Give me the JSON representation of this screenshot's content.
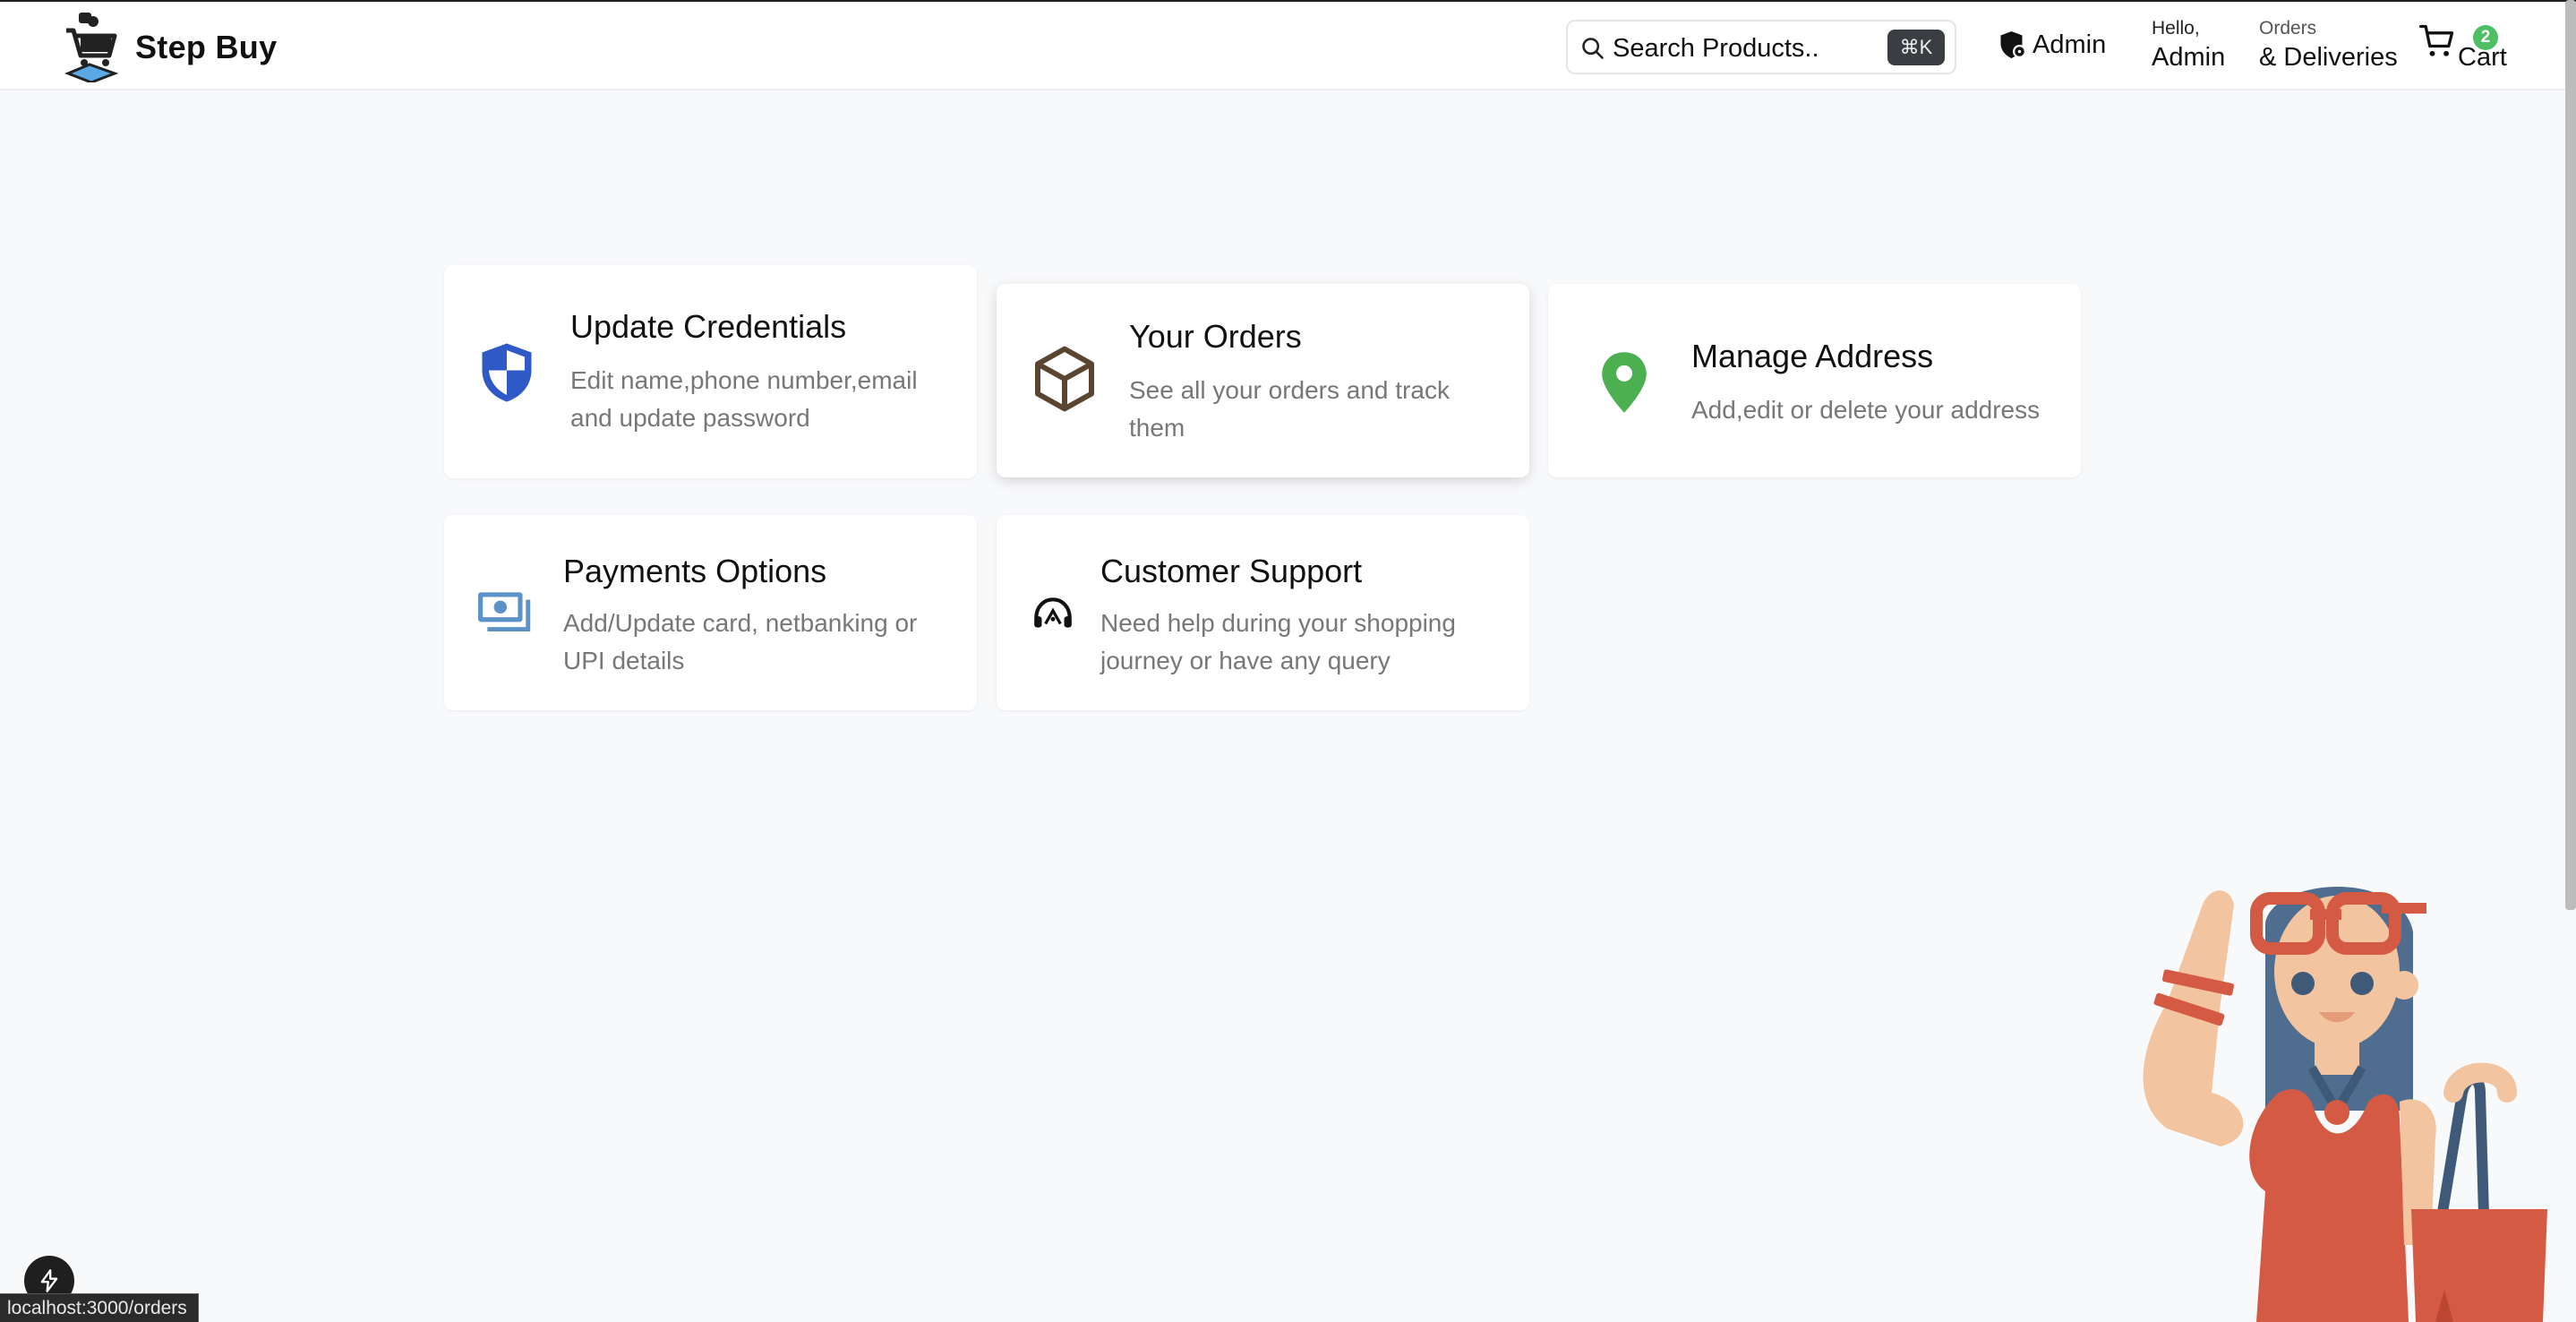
{
  "header": {
    "brand": "Step Buy",
    "search": {
      "placeholder": "Search Products..",
      "shortcut": "⌘K"
    },
    "admin_label": "Admin",
    "greeting": {
      "small": "Hello,",
      "name": "Admin"
    },
    "orders": {
      "small": "Orders",
      "big": "& Deliveries"
    },
    "cart": {
      "label": "Cart",
      "count": "2",
      "badge_color": "#4fbf63"
    }
  },
  "cards": [
    {
      "title": "Update Credentials",
      "desc": "Edit name,phone number,email and update password",
      "icon": "shield-icon",
      "color": "#2f59c7"
    },
    {
      "title": "Your Orders",
      "desc": "See all your orders and track them",
      "icon": "box-icon",
      "color": "#5a4530"
    },
    {
      "title": "Manage Address",
      "desc": "Add,edit or delete your address",
      "icon": "location-pin-icon",
      "color": "#4caf50"
    },
    {
      "title": "Payments Options",
      "desc": "Add/Update card, netbanking or UPI details",
      "icon": "money-icon",
      "color": "#5b92c7"
    },
    {
      "title": "Customer Support",
      "desc": "Need help during your shopping journey or have any query",
      "icon": "headset-icon",
      "color": "#111111"
    }
  ],
  "status_bar": {
    "url": "localhost:3000/orders"
  }
}
